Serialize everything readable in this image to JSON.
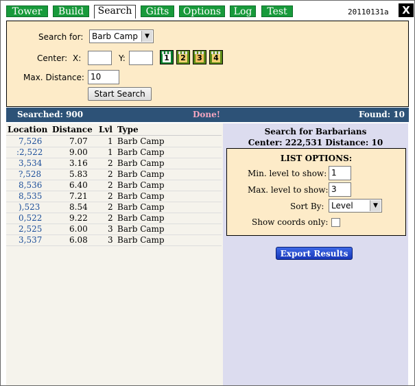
{
  "tabs": [
    {
      "label": "Tower"
    },
    {
      "label": "Build"
    },
    {
      "label": "Search"
    },
    {
      "label": "Gifts"
    },
    {
      "label": "Options"
    },
    {
      "label": "Log"
    },
    {
      "label": "Test"
    }
  ],
  "version": "20110131a",
  "close_label": "X",
  "search": {
    "search_for_label": "Search for:",
    "search_for_value": "Barb Camp",
    "center_label": "Center:",
    "x_label": "X:",
    "y_label": "Y:",
    "x_value": "",
    "y_value": "",
    "tower_buttons": [
      "1",
      "2",
      "3",
      "4"
    ],
    "max_distance_label": "Max. Distance:",
    "max_distance_value": "10",
    "start_button": "Start Search"
  },
  "status": {
    "searched": "Searched: 900",
    "done": "Done!",
    "found": "Found: 10"
  },
  "results": {
    "headers": [
      "Location",
      "Distance",
      "Lvl",
      "Type"
    ],
    "rows": [
      {
        "location": "7,526",
        "distance": "7.07",
        "lvl": "1",
        "type": "Barb Camp"
      },
      {
        "location": ":2,522",
        "distance": "9.00",
        "lvl": "1",
        "type": "Barb Camp"
      },
      {
        "location": "3,534",
        "distance": "3.16",
        "lvl": "2",
        "type": "Barb Camp"
      },
      {
        "location": "?,528",
        "distance": "5.83",
        "lvl": "2",
        "type": "Barb Camp"
      },
      {
        "location": "8,536",
        "distance": "6.40",
        "lvl": "2",
        "type": "Barb Camp"
      },
      {
        "location": "8,535",
        "distance": "7.21",
        "lvl": "2",
        "type": "Barb Camp"
      },
      {
        "location": "),523",
        "distance": "8.54",
        "lvl": "2",
        "type": "Barb Camp"
      },
      {
        "location": "0,522",
        "distance": "9.22",
        "lvl": "2",
        "type": "Barb Camp"
      },
      {
        "location": "2,525",
        "distance": "6.00",
        "lvl": "3",
        "type": "Barb Camp"
      },
      {
        "location": "3,537",
        "distance": "6.08",
        "lvl": "3",
        "type": "Barb Camp"
      }
    ]
  },
  "summary": {
    "title": "Search for Barbarians",
    "center_line": "Center: 222,531   Distance: 10"
  },
  "list_options": {
    "title": "LIST OPTIONS:",
    "min_label": "Min. level to show:",
    "min_value": "1",
    "max_label": "Max. level to show:",
    "max_value": "3",
    "sort_label": "Sort By:",
    "sort_value": "Level",
    "coords_label": "Show coords only:"
  },
  "export_button": "Export Results",
  "colors": {
    "tab_green": "#189a3b",
    "panel_beige": "#fdebc8",
    "status_blue": "#2d5277",
    "done_pink": "#f4a6c0",
    "right_pane": "#dcdcef",
    "export_blue": "#2448d0"
  }
}
